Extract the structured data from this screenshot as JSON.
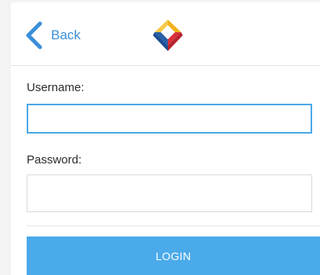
{
  "header": {
    "back_label": "Back",
    "logo_icon": "app-logo"
  },
  "form": {
    "username_label": "Username:",
    "username_value": "",
    "username_placeholder": "",
    "password_label": "Password:",
    "password_value": "",
    "password_placeholder": "",
    "login_label": "LOGIN"
  },
  "colors": {
    "accent": "#3b8fd9",
    "button": "#4aaaea",
    "logo_blue": "#2a5fa8",
    "logo_red": "#d6313a",
    "logo_yellow": "#f2b21b"
  }
}
